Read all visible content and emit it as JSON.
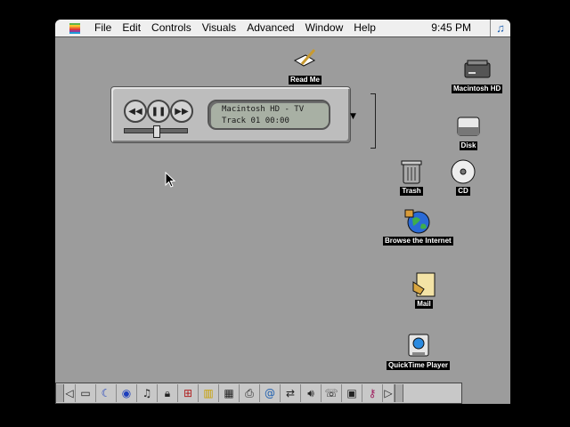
{
  "menubar": {
    "items": [
      "File",
      "Edit",
      "Controls",
      "Visuals",
      "Advanced",
      "Window",
      "Help"
    ],
    "clock": "9:45 PM"
  },
  "player": {
    "buttons": [
      "◀◀",
      "❚❚",
      "▶▶"
    ],
    "display_line1": "Macintosh HD - TV",
    "display_line2": "Track 01  00:00"
  },
  "desktop": {
    "icons": [
      {
        "name": "hard-disk",
        "label": "Macintosh HD"
      },
      {
        "name": "text-file",
        "label": "Read Me"
      },
      {
        "name": "disk",
        "label": "Disk"
      },
      {
        "name": "trash",
        "label": "Trash"
      },
      {
        "name": "cd",
        "label": "CD"
      },
      {
        "name": "browse-internet",
        "label": "Browse the Internet"
      },
      {
        "name": "mail",
        "label": "Mail"
      },
      {
        "name": "quicktime-player",
        "label": "QuickTime Player"
      }
    ]
  },
  "control_strip": {
    "icons": [
      "monitor-icon",
      "sleep-icon",
      "cd-icon",
      "music-icon",
      "lock-icon",
      "network-icon",
      "colors-icon",
      "grid-icon",
      "printer-icon",
      "internet-icon",
      "file-sharing-icon",
      "sound-icon",
      "speech-icon",
      "remote-icon",
      "keychain-icon"
    ]
  }
}
